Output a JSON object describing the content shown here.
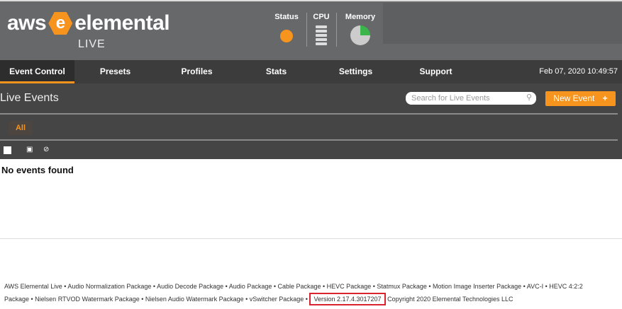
{
  "header": {
    "logo_left": "aws",
    "logo_mark": "e",
    "logo_right": "elemental",
    "product": "LIVE",
    "monitors": {
      "status": "Status",
      "cpu": "CPU",
      "memory": "Memory",
      "memory_used_fraction": 0.25
    }
  },
  "nav": {
    "tabs": [
      "Event Control",
      "Presets",
      "Profiles",
      "Stats",
      "Settings",
      "Support"
    ],
    "active": "Event Control",
    "datetime": "Feb 07, 2020 10:49:57"
  },
  "main": {
    "title": "Live Events",
    "search_placeholder": "Search for Live Events",
    "new_event": "New Event",
    "new_event_icon": "+",
    "filter_all": "All",
    "empty": "No events found"
  },
  "footer": {
    "line1": "AWS Elemental Live • Audio Normalization Package • Audio Decode Package • Audio Package • Cable Package • HEVC Package • Statmux Package • Motion Image Inserter Package • AVC-I • HEVC 4:2:2",
    "line2": "Package • Nielsen RTVOD Watermark Package • Nielsen Audio Watermark Package • vSwitcher Package •",
    "version": "Version 2.17.4.3017207",
    "copyright": "Copyright 2020 Elemental Technologies LLC"
  },
  "colors": {
    "accent": "#f7941d",
    "memory": "#3ab54a"
  }
}
